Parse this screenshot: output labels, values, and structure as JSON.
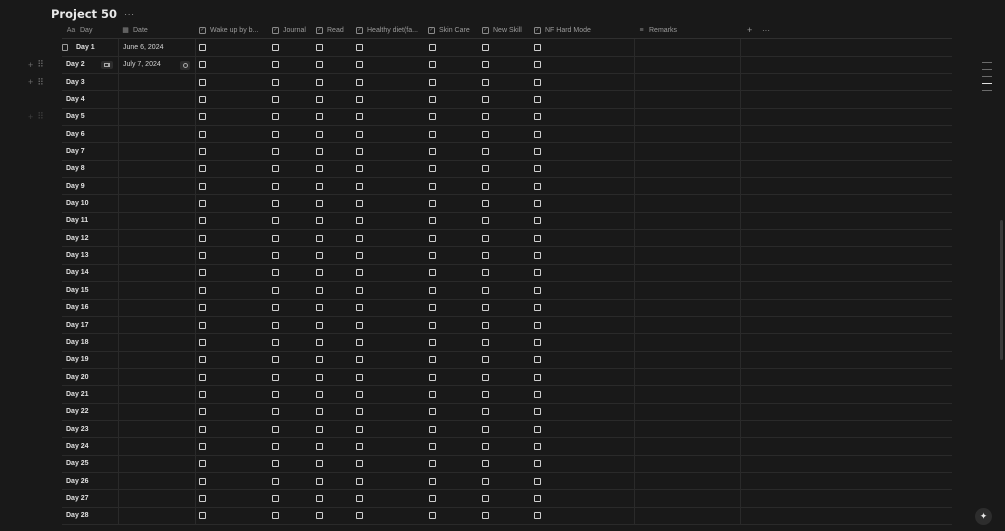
{
  "title": "Project 50",
  "title_more_icon": "more-horizontal-icon",
  "columns": [
    {
      "label": "Day",
      "icon": "Aa"
    },
    {
      "label": "Date",
      "icon": "calendar-icon"
    },
    {
      "label": "Wake up by b...",
      "icon": "checkbox-icon"
    },
    {
      "label": "Journal",
      "icon": "checkbox-icon"
    },
    {
      "label": "Read",
      "icon": "checkbox-icon"
    },
    {
      "label": "Healthy diet(fa...",
      "icon": "checkbox-icon"
    },
    {
      "label": "Skin Care",
      "icon": "checkbox-icon"
    },
    {
      "label": "New Skill",
      "icon": "checkbox-icon"
    },
    {
      "label": "NF Hard Mode",
      "icon": "checkbox-icon"
    },
    {
      "label": "Remarks",
      "icon": "text-lines-icon"
    }
  ],
  "add_column_icon": "+",
  "more_icon": "···",
  "rows": [
    {
      "day": "Day 1",
      "date": "June 6, 2024"
    },
    {
      "day": "Day 2",
      "date": "July 7, 2024"
    },
    {
      "day": "Day 3",
      "date": ""
    },
    {
      "day": "Day 4",
      "date": ""
    },
    {
      "day": "Day 5",
      "date": ""
    },
    {
      "day": "Day 6",
      "date": ""
    },
    {
      "day": "Day 7",
      "date": ""
    },
    {
      "day": "Day 8",
      "date": ""
    },
    {
      "day": "Day 9",
      "date": ""
    },
    {
      "day": "Day 10",
      "date": ""
    },
    {
      "day": "Day 11",
      "date": ""
    },
    {
      "day": "Day 12",
      "date": ""
    },
    {
      "day": "Day 13",
      "date": ""
    },
    {
      "day": "Day 14",
      "date": ""
    },
    {
      "day": "Day 15",
      "date": ""
    },
    {
      "day": "Day 16",
      "date": ""
    },
    {
      "day": "Day 17",
      "date": ""
    },
    {
      "day": "Day 18",
      "date": ""
    },
    {
      "day": "Day 19",
      "date": ""
    },
    {
      "day": "Day 20",
      "date": ""
    },
    {
      "day": "Day 21",
      "date": ""
    },
    {
      "day": "Day 22",
      "date": ""
    },
    {
      "day": "Day 23",
      "date": ""
    },
    {
      "day": "Day 24",
      "date": ""
    },
    {
      "day": "Day 25",
      "date": ""
    },
    {
      "day": "Day 26",
      "date": ""
    },
    {
      "day": "Day 27",
      "date": ""
    },
    {
      "day": "Day 28",
      "date": ""
    }
  ],
  "colors": {
    "background": "#191919",
    "text": "#d4d4d4",
    "muted": "#9b9b9b",
    "grid": "#2a2a2a"
  },
  "ai_button_icon": "sparkle-icon"
}
